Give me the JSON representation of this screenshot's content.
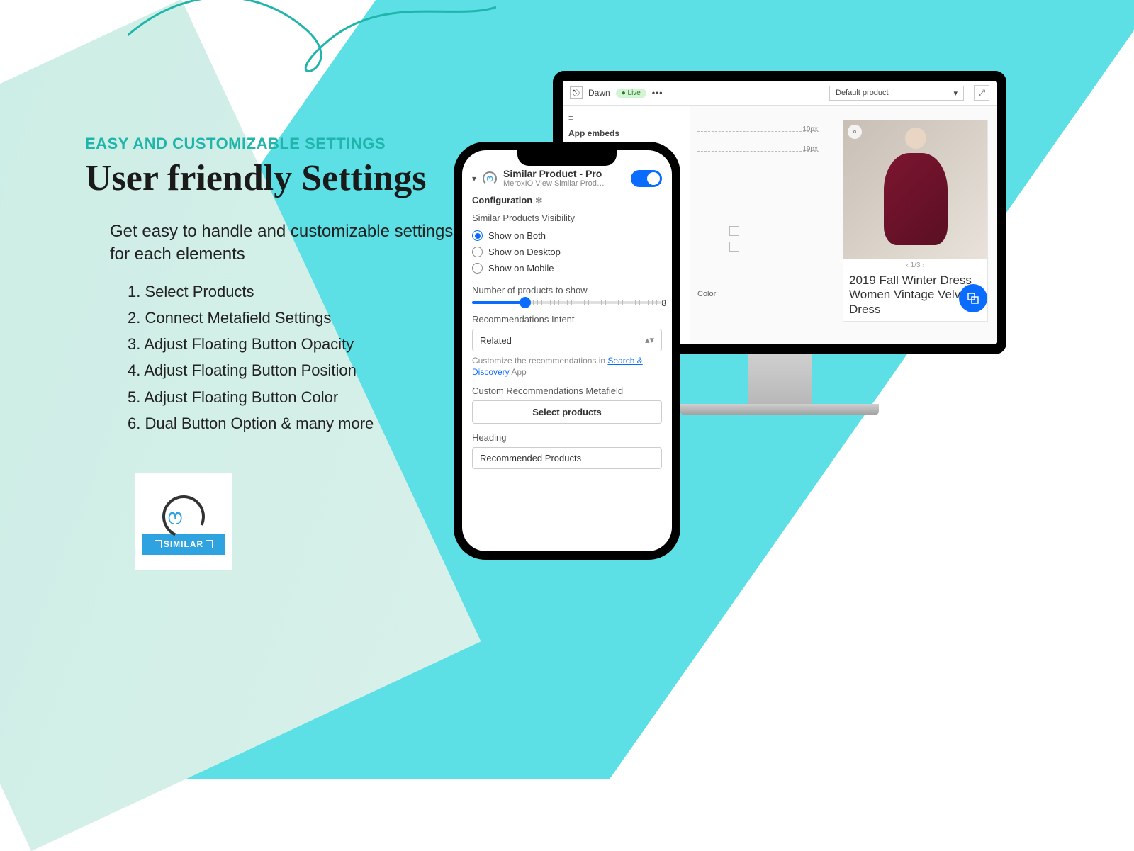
{
  "copy": {
    "eyebrow": "EASY AND CUSTOMIZABLE SETTINGS",
    "headline": "User friendly Settings",
    "lead": "Get easy to handle and customizable settings for each elements",
    "features": [
      "1. Select Products",
      "2. Connect Metafield Settings",
      "3. Adjust Floating Button Opacity",
      "4. Adjust Floating Button Position",
      "5. Adjust Floating Button Color",
      "6. Dual Button Option & many more"
    ]
  },
  "logo": {
    "brand": "SIMILAR"
  },
  "monitor": {
    "theme": "Dawn",
    "live": "● Live",
    "dots": "•••",
    "default_product": "Default product",
    "app_embeds": "App embeds",
    "guide1": "10px",
    "guide2": "19px",
    "color": "Color",
    "pager": "‹    1/3    ›",
    "product_title": "2019 Fall Winter Dress Women Vintage Velvet Dress"
  },
  "phone": {
    "app_title": "Similar Product - Pro",
    "app_sub": "MeroxIO View Similar Prod…",
    "config": "Configuration",
    "visibility_label": "Similar Products Visibility",
    "radios": [
      "Show on Both",
      "Show on Desktop",
      "Show on Mobile"
    ],
    "num_label": "Number of products to show",
    "num_value": "8",
    "intent_label": "Recommendations Intent",
    "intent_value": "Related",
    "hint_pre": "Customize the recommendations in ",
    "hint_link": "Search & Discovery",
    "hint_post": " App",
    "meta_label": "Custom Recommendations Metafield",
    "select_products": "Select products",
    "heading_label": "Heading",
    "heading_value": "Recommended Products"
  }
}
